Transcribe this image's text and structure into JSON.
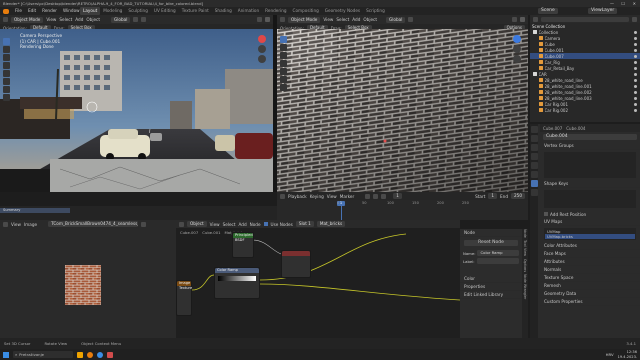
{
  "title_bar": {
    "text": "Blender* [C:\\Users\\pc\\Desktop\\blender\\RETRO\\ALPHA-9_4_FOR_BAD_TUTORIAL\\4_for_bike_colored.blend]"
  },
  "menu": [
    "File",
    "Edit",
    "Render",
    "Window",
    "Help"
  ],
  "workspaces": [
    "Layout",
    "Modeling",
    "Sculpting",
    "UV Editing",
    "Texture Paint",
    "Shading",
    "Animation",
    "Rendering",
    "Compositing",
    "Geometry Nodes",
    "Scripting"
  ],
  "active_workspace": "Layout",
  "top_right": {
    "scene": "Scene",
    "view_layer": "ViewLayer"
  },
  "viewport_left": {
    "mode": "Object Mode",
    "menus": [
      "View",
      "Select",
      "Add",
      "Object"
    ],
    "transform": "Global",
    "orientation_label": "Orientation:",
    "orientation_value": "Default",
    "drag_label": "Drag:",
    "drag_value": "Select Box",
    "overlay_lines": [
      "Camera Perspective",
      "(1) CAR | Cube.001",
      "Rendering Done"
    ]
  },
  "viewport_right": {
    "mode": "Object Mode",
    "menus": [
      "View",
      "Select",
      "Add",
      "Object"
    ],
    "transform": "Global",
    "orientation_label": "Orientation:",
    "orientation_value": "Default",
    "drag_label": "Drag:",
    "drag_value": "Select Box",
    "options": "Options"
  },
  "timeline": {
    "menus": [
      "Playback",
      "Keying",
      "View",
      "Marker"
    ],
    "current_frame": "1",
    "start_label": "Start",
    "start": "1",
    "end_label": "End",
    "end": "250",
    "ticks": [
      "0",
      "50",
      "100",
      "150",
      "200",
      "250"
    ],
    "summary": "Summary"
  },
  "image_editor": {
    "menus": [
      "View",
      "Image"
    ],
    "image_name": "TCom_BrickSmallBrown0474_4_seamless_S.jpg"
  },
  "node_editor": {
    "mode": "Object",
    "menus": [
      "View",
      "Select",
      "Add",
      "Node"
    ],
    "use_nodes": "Use Nodes",
    "slot": "Slot 1",
    "material": "Mat_bricks",
    "breadcrumb": [
      "Cube.007",
      "Cube.001",
      "Mat_bricks"
    ],
    "node_tex": "Image Texture",
    "node_ramp": "Color Ramp",
    "node_bsdf": "Principled BSDF",
    "side_panel": {
      "node_section": "Node",
      "reset_node": "Reset Node",
      "name_label": "Name:",
      "name_value": "Color Ramp",
      "label_label": "Label:",
      "color_section": "Color",
      "properties_section": "Properties",
      "edit_linked": "Edit Linked Library"
    },
    "side_tabs": [
      "Node",
      "Tool",
      "View",
      "Options",
      "Node Wrangler"
    ]
  },
  "outliner": {
    "title": "Scene Collection",
    "items": [
      {
        "name": "Collection",
        "indent": 0,
        "sel": false
      },
      {
        "name": "Camera",
        "indent": 1,
        "sel": false
      },
      {
        "name": "Cube",
        "indent": 1,
        "sel": false
      },
      {
        "name": "Cube.001",
        "indent": 1,
        "sel": false
      },
      {
        "name": "Cube.007",
        "indent": 1,
        "sel": true
      },
      {
        "name": "Car_Rig",
        "indent": 1,
        "sel": false
      },
      {
        "name": "Car_Retail_Bay",
        "indent": 1,
        "sel": false
      },
      {
        "name": "CAR",
        "indent": 0,
        "sel": false
      },
      {
        "name": "28_white_road_line",
        "indent": 1,
        "sel": false
      },
      {
        "name": "28_white_road_line.001",
        "indent": 1,
        "sel": false
      },
      {
        "name": "28_white_road_line.002",
        "indent": 1,
        "sel": false
      },
      {
        "name": "28_white_road_line.003",
        "indent": 1,
        "sel": false
      },
      {
        "name": "Car Rig.001",
        "indent": 1,
        "sel": false
      },
      {
        "name": "Car Rig.002",
        "indent": 1,
        "sel": false
      }
    ]
  },
  "properties": {
    "object_name": "Cube.007",
    "mesh_name": "Cube.004",
    "mesh_field": "Cube.004",
    "sections": [
      "Vertex Groups",
      "Shape Keys",
      "UV Maps",
      "Color Attributes",
      "Face Maps",
      "Attributes",
      "Normals",
      "Texture Space",
      "Remesh",
      "Geometry Data",
      "Custom Properties"
    ],
    "rest_position": "Add Rest Position",
    "uv_maps": [
      "UVMap",
      "UVMap.bricks"
    ]
  },
  "status_bar": {
    "left": "Set 3D Cursor",
    "mid1": "Rotate View",
    "mid2": "Object Context Menu",
    "version": "3.4.1"
  },
  "taskbar": {
    "search": "Pretraživanje",
    "time": "12:36",
    "date": "19.4.2023.",
    "lang": "HRV"
  }
}
